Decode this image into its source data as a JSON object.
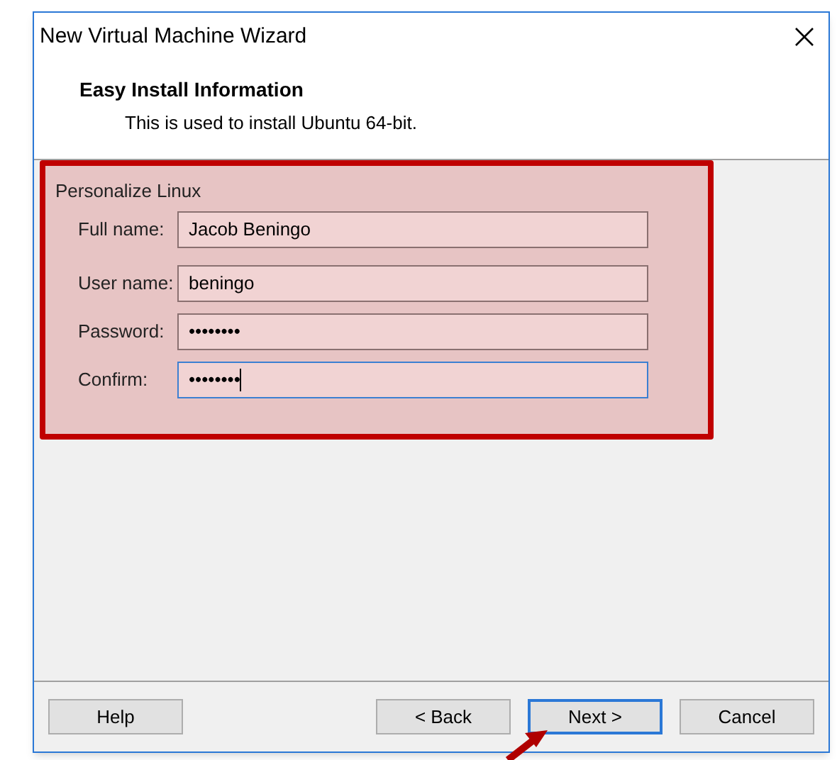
{
  "window": {
    "title": "New Virtual Machine Wizard"
  },
  "header": {
    "title": "Easy Install Information",
    "subtitle": "This is used to install Ubuntu 64-bit."
  },
  "group": {
    "title": "Personalize Linux"
  },
  "fields": [
    {
      "label": "Full name:",
      "value": "Jacob Beningo",
      "focused": false
    },
    {
      "label": "User name:",
      "value": "beningo",
      "focused": false
    },
    {
      "label": "Password:",
      "value": "••••••••",
      "focused": false
    },
    {
      "label": "Confirm:",
      "value": "••••••••",
      "focused": true
    }
  ],
  "buttons": [
    {
      "label": "Help",
      "focused": false
    },
    {
      "label": "< Back",
      "focused": false
    },
    {
      "label": "Next >",
      "focused": true
    },
    {
      "label": "Cancel",
      "focused": false
    }
  ]
}
